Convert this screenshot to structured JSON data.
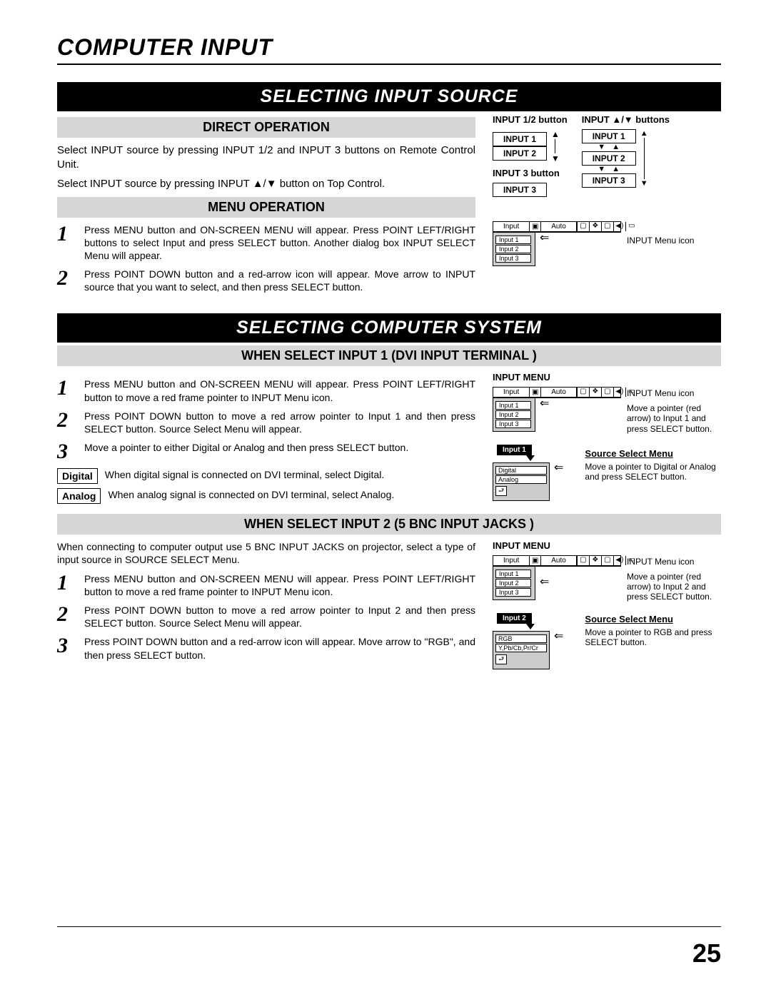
{
  "pageTitle": "COMPUTER INPUT",
  "section1": {
    "bar": "SELECTING INPUT SOURCE",
    "direct": {
      "title": "DIRECT OPERATION",
      "p1": "Select INPUT source by pressing INPUT 1/2 and INPUT 3 buttons on Remote Control Unit.",
      "p2": "Select INPUT source by pressing INPUT ▲/▼ button on Top Control."
    },
    "menuOp": {
      "title": "MENU OPERATION",
      "step1": "Press MENU button and ON-SCREEN MENU will appear.  Press POINT LEFT/RIGHT buttons to select Input and press  SELECT button.  Another dialog box INPUT SELECT Menu will appear.",
      "step2": "Press POINT DOWN button and a red-arrow icon will appear. Move arrow to INPUT source that you want to select, and then press SELECT button."
    },
    "diagram": {
      "label12": "INPUT 1/2 button",
      "labelArrows": "INPUT ▲/▼  buttons",
      "in1": "INPUT 1",
      "in2": "INPUT 2",
      "label3": "INPUT 3 button",
      "in3": "INPUT 3"
    },
    "menuDiagram": {
      "tab": "Input",
      "auto": "Auto",
      "items": [
        "Input 1",
        "Input 2",
        "Input 3"
      ],
      "caption": "INPUT Menu icon"
    }
  },
  "section2": {
    "bar": "SELECTING COMPUTER SYSTEM",
    "dvi": {
      "title": "WHEN SELECT  INPUT 1 (DVI INPUT TERMINAL )",
      "step1": "Press MENU button and ON-SCREEN MENU will appear.  Press POINT LEFT/RIGHT button to move a red frame pointer to INPUT Menu icon.",
      "step2": "Press POINT DOWN button to move a red arrow pointer to Input 1 and then press SELECT button.  Source Select Menu will appear.",
      "step3": "Move a pointer to either Digital or Analog and then press SELECT button.",
      "digitalLabel": "Digital",
      "digitalText": "When digital signal is connected on DVI terminal, select Digital.",
      "analogLabel": "Analog",
      "analogText": "When analog signal is connected on DVI terminal, select Analog.",
      "rightTitle": "INPUT MENU",
      "menu": {
        "tab": "Input",
        "auto": "Auto",
        "items": [
          "Input 1",
          "Input 2",
          "Input 3"
        ]
      },
      "caption1": "INPUT Menu icon",
      "caption2": "Move a pointer (red arrow) to Input 1 and press SELECT button.",
      "selTab": "Input 1",
      "srcTitle": "Source Select Menu",
      "srcItems": [
        "Digital",
        "Analog"
      ],
      "srcCaption": "Move a pointer to Digital or Analog and press SELECT button."
    },
    "bnc": {
      "title": "WHEN SELECT INPUT 2 (5 BNC INPUT JACKS )",
      "intro": "When connecting to computer output use 5 BNC INPUT JACKS on projector, select a type of input source in SOURCE SELECT Menu.",
      "step1": "Press MENU button and ON-SCREEN MENU will appear.  Press POINT LEFT/RIGHT button to move a red frame pointer to INPUT Menu icon.",
      "step2": "Press POINT DOWN button to move a red arrow pointer to Input 2 and then press SELECT button.  Source Select Menu will appear.",
      "step3": "Press POINT DOWN button and a red-arrow icon will appear. Move arrow to \"RGB\", and then press SELECT button.",
      "rightTitle": "INPUT MENU",
      "menu": {
        "tab": "Input",
        "auto": "Auto",
        "items": [
          "Input 1",
          "Input 2",
          "Input 3"
        ]
      },
      "caption1": "INPUT Menu icon",
      "caption2": "Move a pointer (red arrow) to Input 2 and press SELECT button.",
      "selTab": "Input 2",
      "srcTitle": "Source Select Menu",
      "srcItems": [
        "RGB",
        "Y,Pb/Cb,Pr/Cr"
      ],
      "srcCaption": "Move a pointer to RGB and press SELECT button."
    }
  },
  "nums": {
    "n1": "1",
    "n2": "2",
    "n3": "3"
  },
  "pageNumber": "25"
}
